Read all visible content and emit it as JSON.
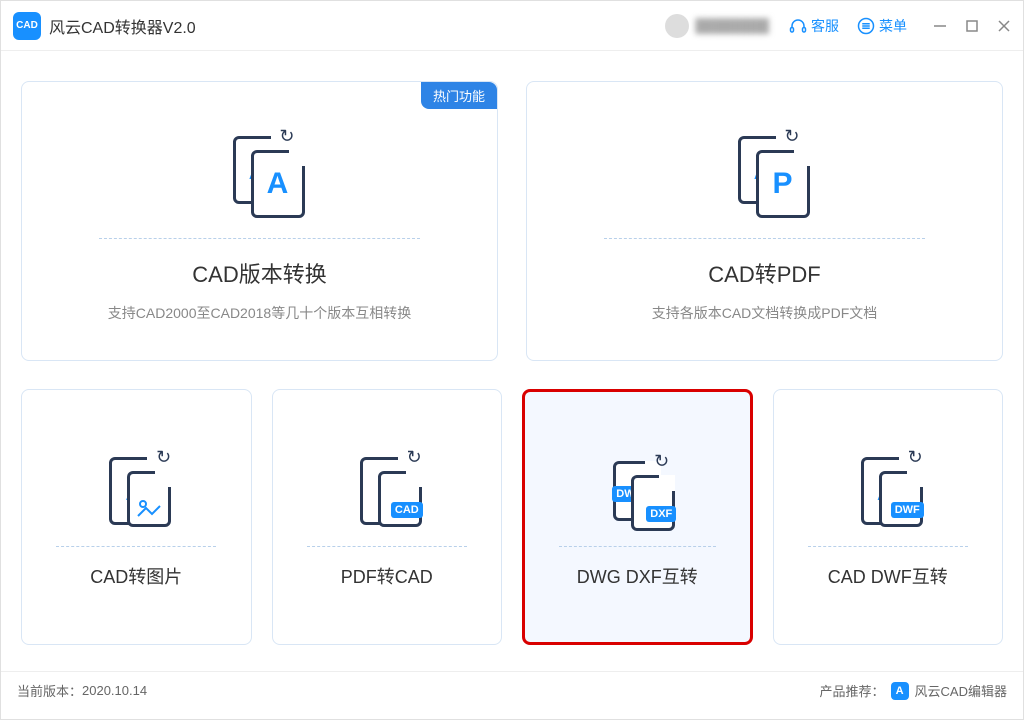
{
  "app": {
    "title": "风云CAD转换器V2.0",
    "logo_text": "CAD"
  },
  "header": {
    "service": "客服",
    "menu": "菜单"
  },
  "cards": {
    "badge": "热门功能",
    "big1": {
      "title": "CAD版本转换",
      "desc": "支持CAD2000至CAD2018等几十个版本互相转换"
    },
    "big2": {
      "title": "CAD转PDF",
      "desc": "支持各版本CAD文档转换成PDF文档"
    },
    "s1": {
      "title": "CAD转图片"
    },
    "s2": {
      "title": "PDF转CAD"
    },
    "s3": {
      "title": "DWG DXF互转"
    },
    "s4": {
      "title": "CAD DWF互转"
    }
  },
  "footer": {
    "version_label": "当前版本：",
    "version": "2020.10.14",
    "recommend_label": "产品推荐：",
    "recommend_name": "风云CAD编辑器",
    "recommend_logo": "A"
  }
}
